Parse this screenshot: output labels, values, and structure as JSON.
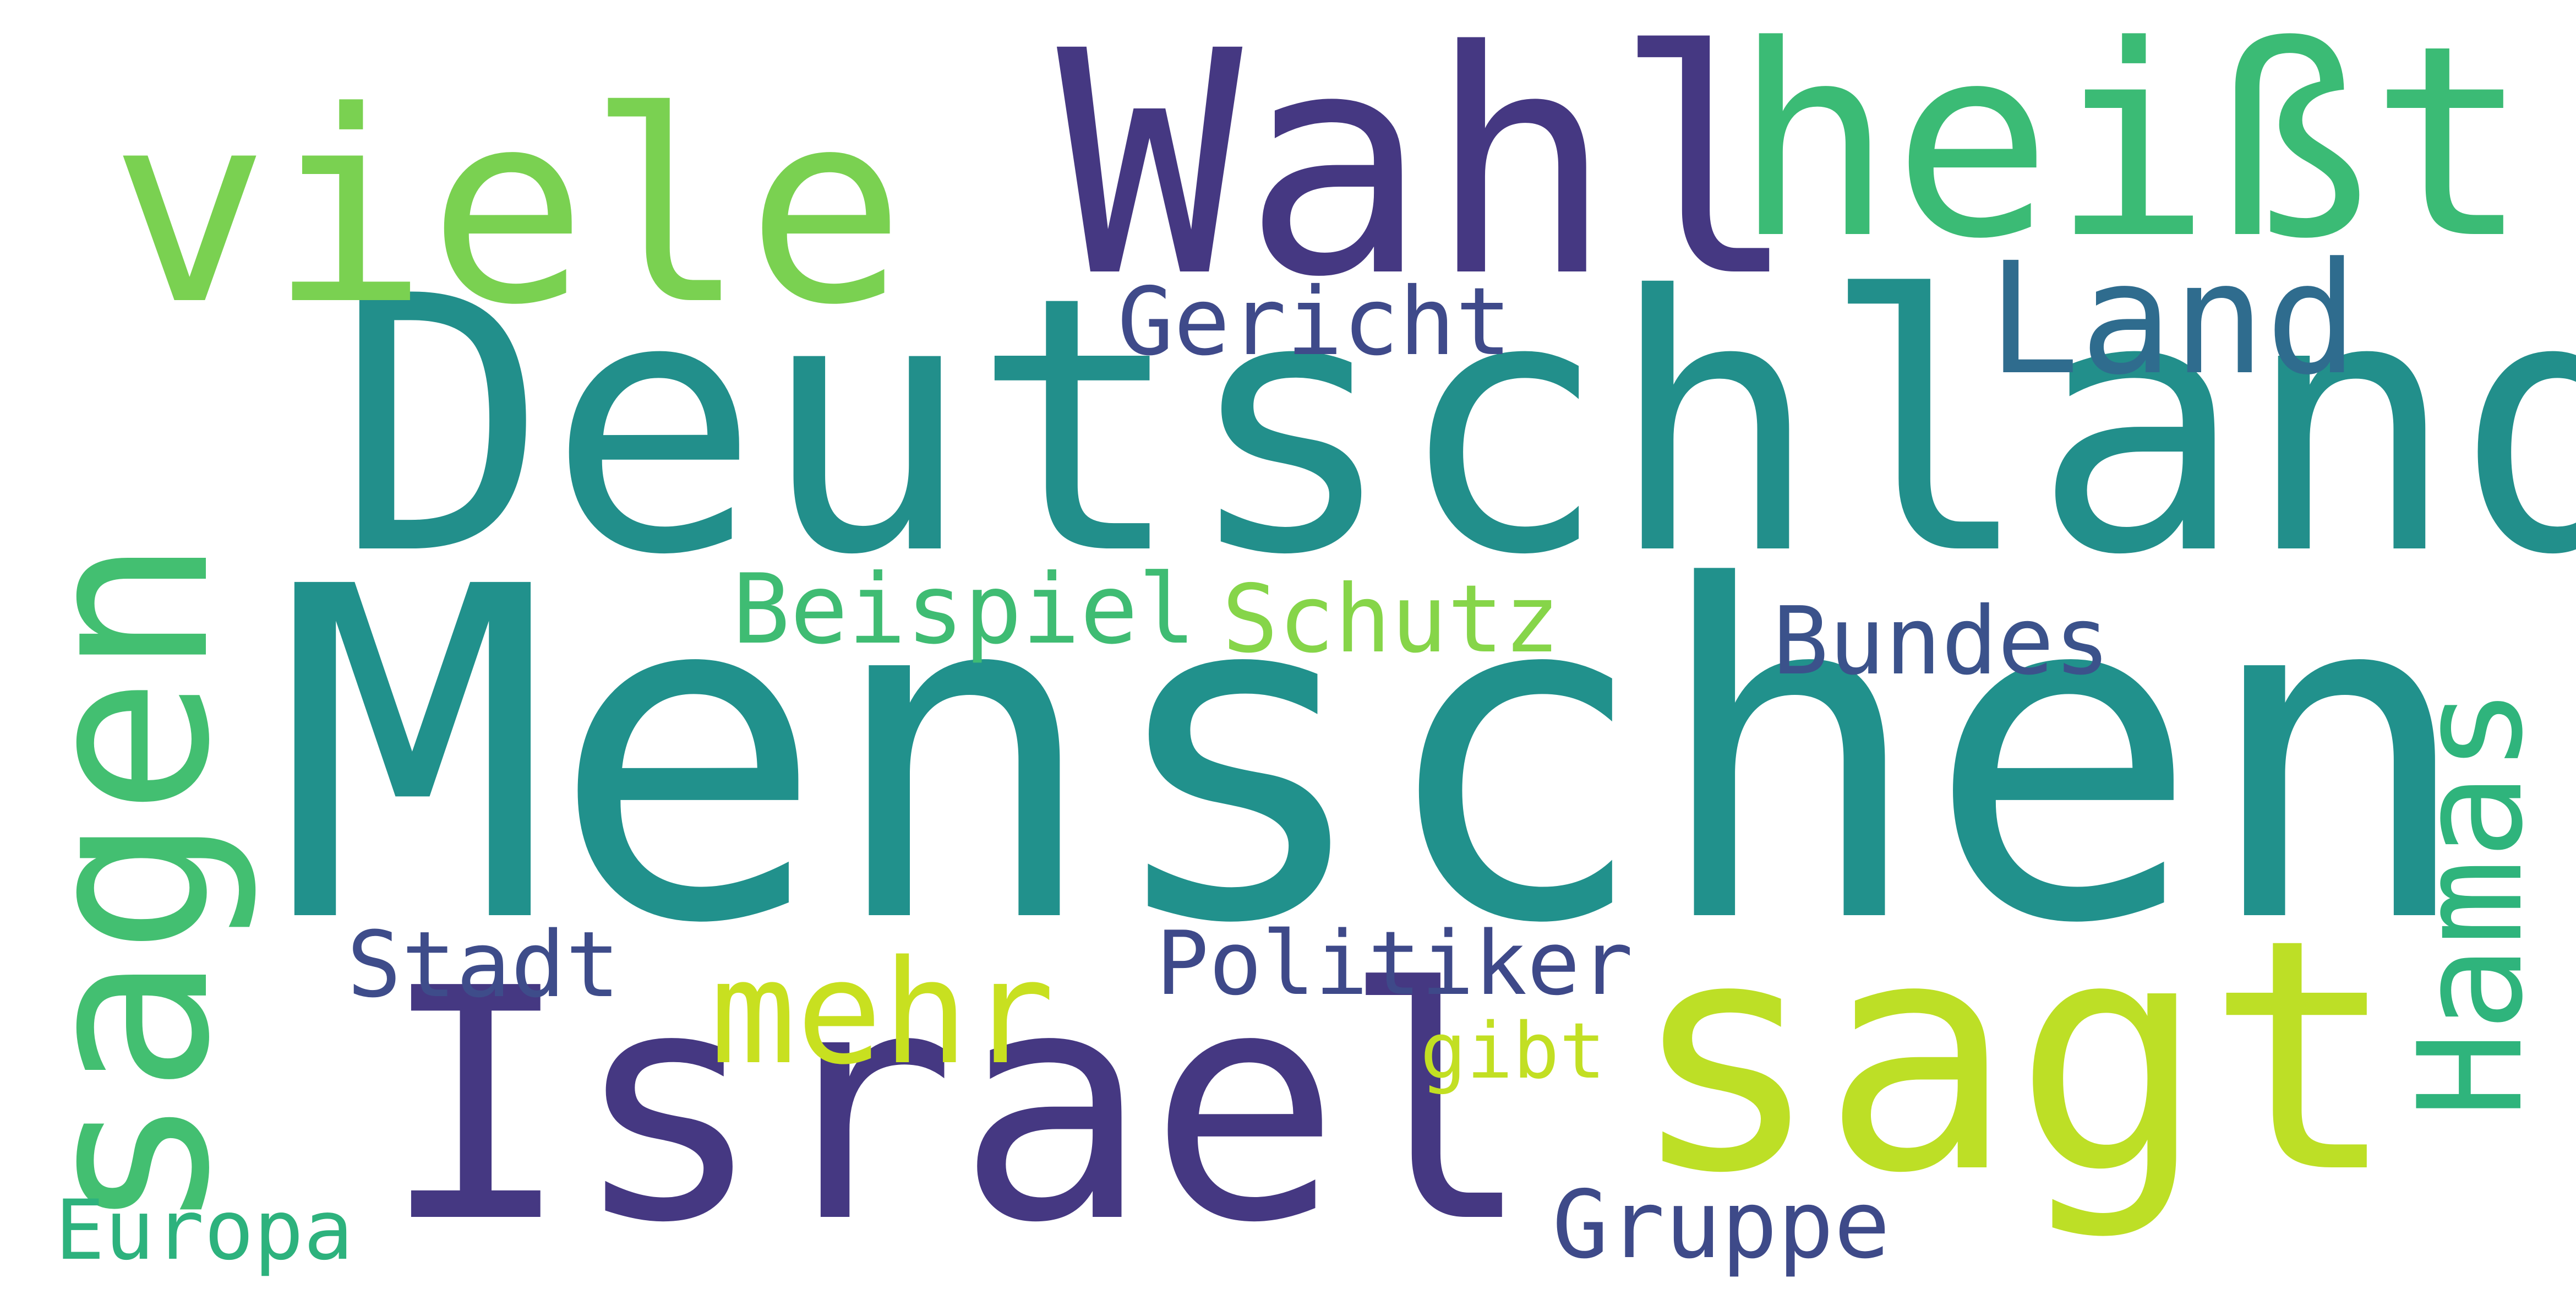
{
  "words": [
    {
      "key": "menschen",
      "text": "Menschen",
      "color": "#21918c",
      "rotated": false
    },
    {
      "key": "deutschland",
      "text": "Deutschland",
      "color": "#228f8b",
      "rotated": false
    },
    {
      "key": "israel",
      "text": "Israel",
      "color": "#453882",
      "rotated": false
    },
    {
      "key": "sagt",
      "text": "sagt",
      "color": "#bddf26",
      "rotated": false
    },
    {
      "key": "wahl",
      "text": "Wahl",
      "color": "#453882",
      "rotated": false
    },
    {
      "key": "viele",
      "text": "viele",
      "color": "#7ad151",
      "rotated": false
    },
    {
      "key": "heisst",
      "text": "heißt",
      "color": "#3bbb75",
      "rotated": false
    },
    {
      "key": "sagen",
      "text": "sagen",
      "color": "#43bf71",
      "rotated": true
    },
    {
      "key": "hamas",
      "text": "Hamas",
      "color": "#2fb47c",
      "rotated": true
    },
    {
      "key": "land",
      "text": "Land",
      "color": "#2f6c8e",
      "rotated": false
    },
    {
      "key": "mehr",
      "text": "mehr",
      "color": "#c8e020",
      "rotated": false
    },
    {
      "key": "gericht",
      "text": "Gericht",
      "color": "#3f4a8a",
      "rotated": false
    },
    {
      "key": "beispiel",
      "text": "Beispiel",
      "color": "#3fbc73",
      "rotated": false
    },
    {
      "key": "schutz",
      "text": "Schutz",
      "color": "#86d549",
      "rotated": false
    },
    {
      "key": "bundes",
      "text": "Bundes",
      "color": "#3b528b",
      "rotated": false
    },
    {
      "key": "stadt",
      "text": "Stadt",
      "color": "#3e4c8a",
      "rotated": false
    },
    {
      "key": "politiker",
      "text": "Politiker",
      "color": "#3e4989",
      "rotated": false
    },
    {
      "key": "gibt",
      "text": "gibt",
      "color": "#c2df23",
      "rotated": false
    },
    {
      "key": "europa",
      "text": "Europa",
      "color": "#2db27d",
      "rotated": false
    },
    {
      "key": "gruppe",
      "text": "Gruppe",
      "color": "#3e4a89",
      "rotated": false
    }
  ]
}
